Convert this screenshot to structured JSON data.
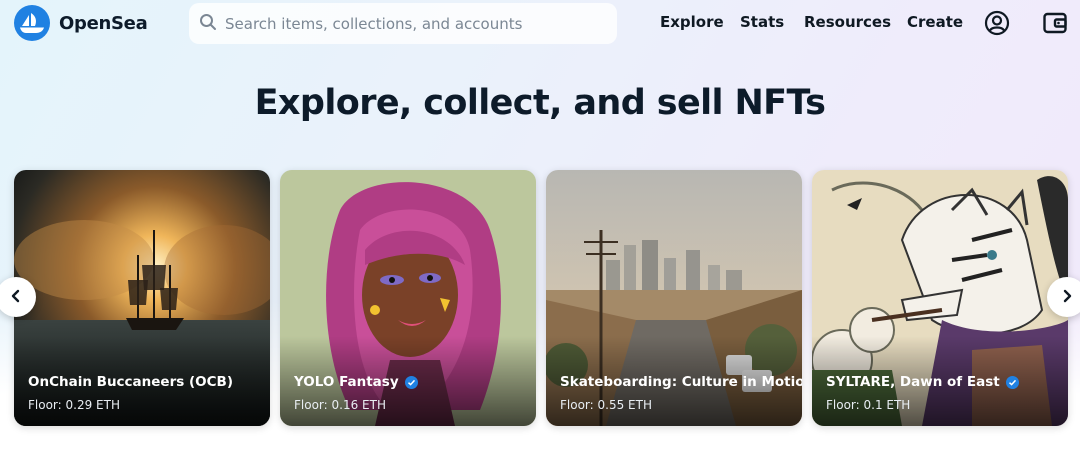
{
  "header": {
    "logo_text": "OpenSea",
    "search_placeholder": "Search items, collections, and accounts",
    "nav": [
      "Explore",
      "Stats",
      "Resources",
      "Create"
    ],
    "icons": [
      "account-icon",
      "wallet-icon"
    ]
  },
  "hero": {
    "title": "Explore, collect, and sell NFTs"
  },
  "cards": [
    {
      "name": "OnChain Buccaneers (OCB)",
      "floor": "Floor: 0.29 ETH",
      "verified": false
    },
    {
      "name": "YOLO Fantasy",
      "floor": "Floor: 0.16 ETH",
      "verified": true
    },
    {
      "name": "Skateboarding: Culture in Motion",
      "floor": "Floor: 0.55 ETH",
      "verified": false
    },
    {
      "name": "SYLTARE, Dawn of East",
      "floor": "Floor: 0.1 ETH",
      "verified": true
    }
  ],
  "colors": {
    "brand": "#2081e2",
    "text": "#0f1923"
  }
}
